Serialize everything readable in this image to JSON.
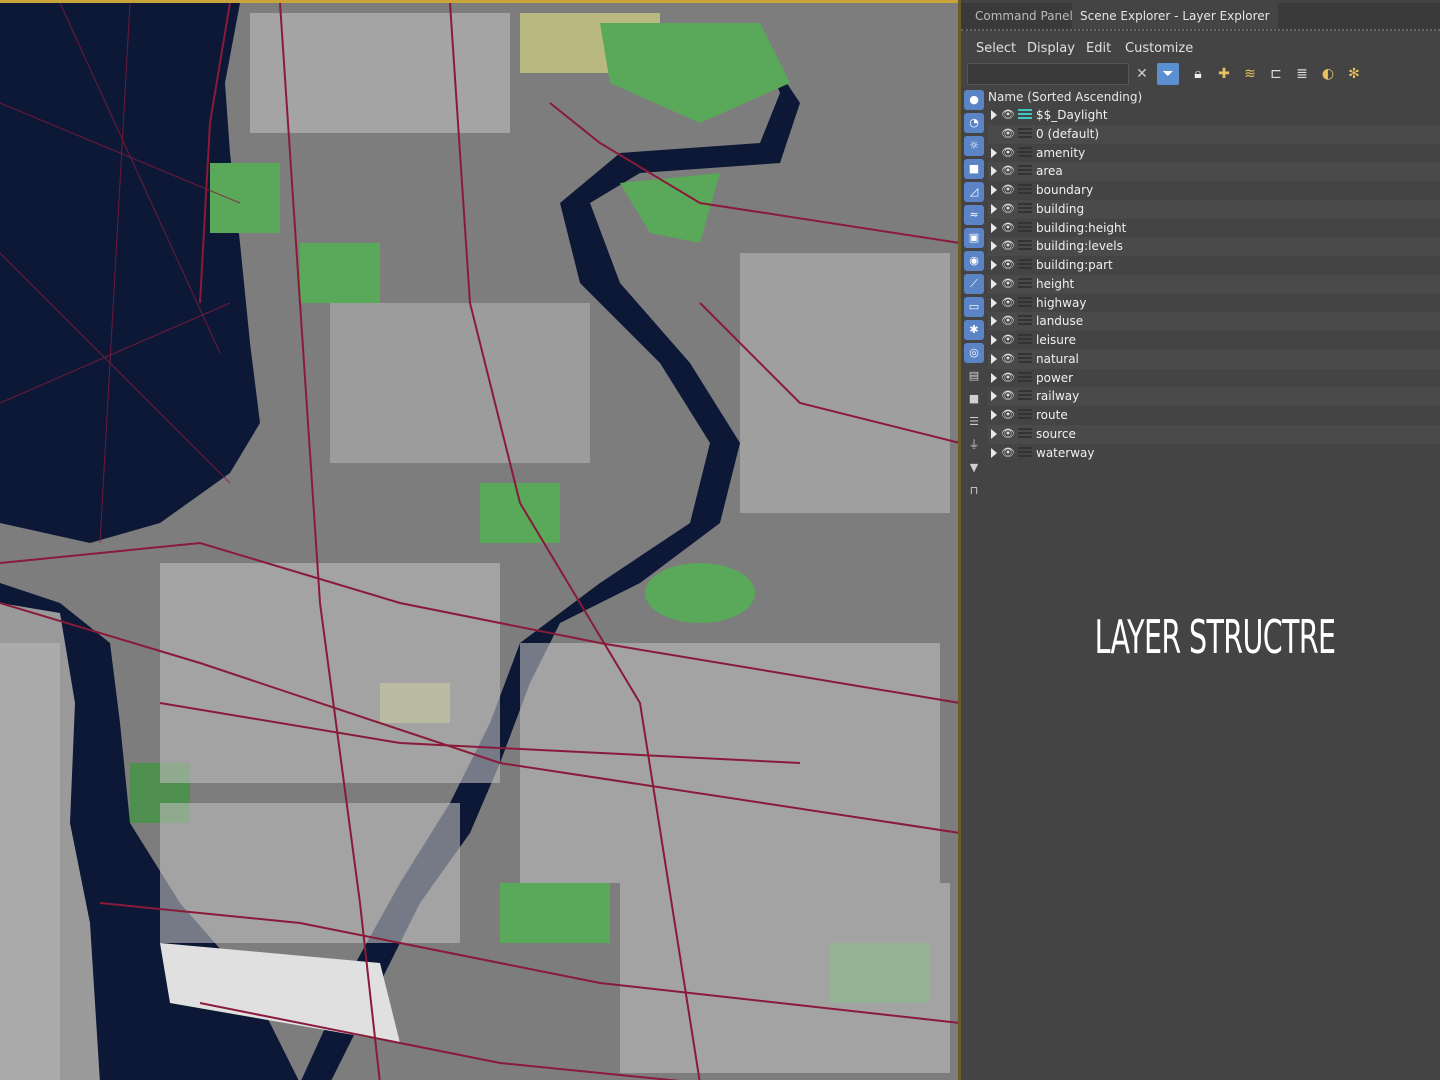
{
  "viewport": {
    "label": "3D city map viewport"
  },
  "tabs": [
    {
      "label": "Command Panel"
    },
    {
      "label": "Scene Explorer - Layer Explorer"
    }
  ],
  "menu": [
    {
      "label": "Select"
    },
    {
      "label": "Display"
    },
    {
      "label": "Edit"
    },
    {
      "label": "Customize"
    }
  ],
  "search": {
    "value": ""
  },
  "toolbar_icons": [
    "close-icon",
    "filter-icon",
    "lock-icon",
    "add-layer-icon",
    "layers-icon",
    "hierarchy-icon",
    "layers-stack-icon",
    "highlight-icon",
    "freeze-icon"
  ],
  "side_icons": [
    "geometry-icon",
    "shapes-icon",
    "light-icon",
    "camera-icon",
    "helper-icon",
    "spacewarp-icon",
    "group-icon",
    "xref-icon",
    "bone-icon",
    "container-icon",
    "particle-icon",
    "hidden-icon",
    "doc-icon",
    "square-icon",
    "list-icon",
    "filter-icon",
    "funnel-icon",
    "frame-icon"
  ],
  "header": {
    "label": "Name (Sorted Ascending)"
  },
  "layers": [
    {
      "name": "$$_Daylight",
      "expand": true,
      "teal": true
    },
    {
      "name": "0 (default)",
      "expand": false,
      "teal": false
    },
    {
      "name": "amenity",
      "expand": true,
      "teal": false
    },
    {
      "name": "area",
      "expand": true,
      "teal": false
    },
    {
      "name": "boundary",
      "expand": true,
      "teal": false
    },
    {
      "name": "building",
      "expand": true,
      "teal": false
    },
    {
      "name": "building:height",
      "expand": true,
      "teal": false
    },
    {
      "name": "building:levels",
      "expand": true,
      "teal": false
    },
    {
      "name": "building:part",
      "expand": true,
      "teal": false
    },
    {
      "name": "height",
      "expand": true,
      "teal": false
    },
    {
      "name": "highway",
      "expand": true,
      "teal": false
    },
    {
      "name": "landuse",
      "expand": true,
      "teal": false
    },
    {
      "name": "leisure",
      "expand": true,
      "teal": false
    },
    {
      "name": "natural",
      "expand": true,
      "teal": false
    },
    {
      "name": "power",
      "expand": true,
      "teal": false
    },
    {
      "name": "railway",
      "expand": true,
      "teal": false
    },
    {
      "name": "route",
      "expand": true,
      "teal": false
    },
    {
      "name": "source",
      "expand": true,
      "teal": false
    },
    {
      "name": "waterway",
      "expand": true,
      "teal": false
    }
  ],
  "caption": "LAYER STRUCTRE",
  "colors": {
    "water": "#0c1836",
    "park": "#5aa85a",
    "building": "#c8c8c8",
    "road": "#8a1a3a",
    "panel": "#444444"
  }
}
